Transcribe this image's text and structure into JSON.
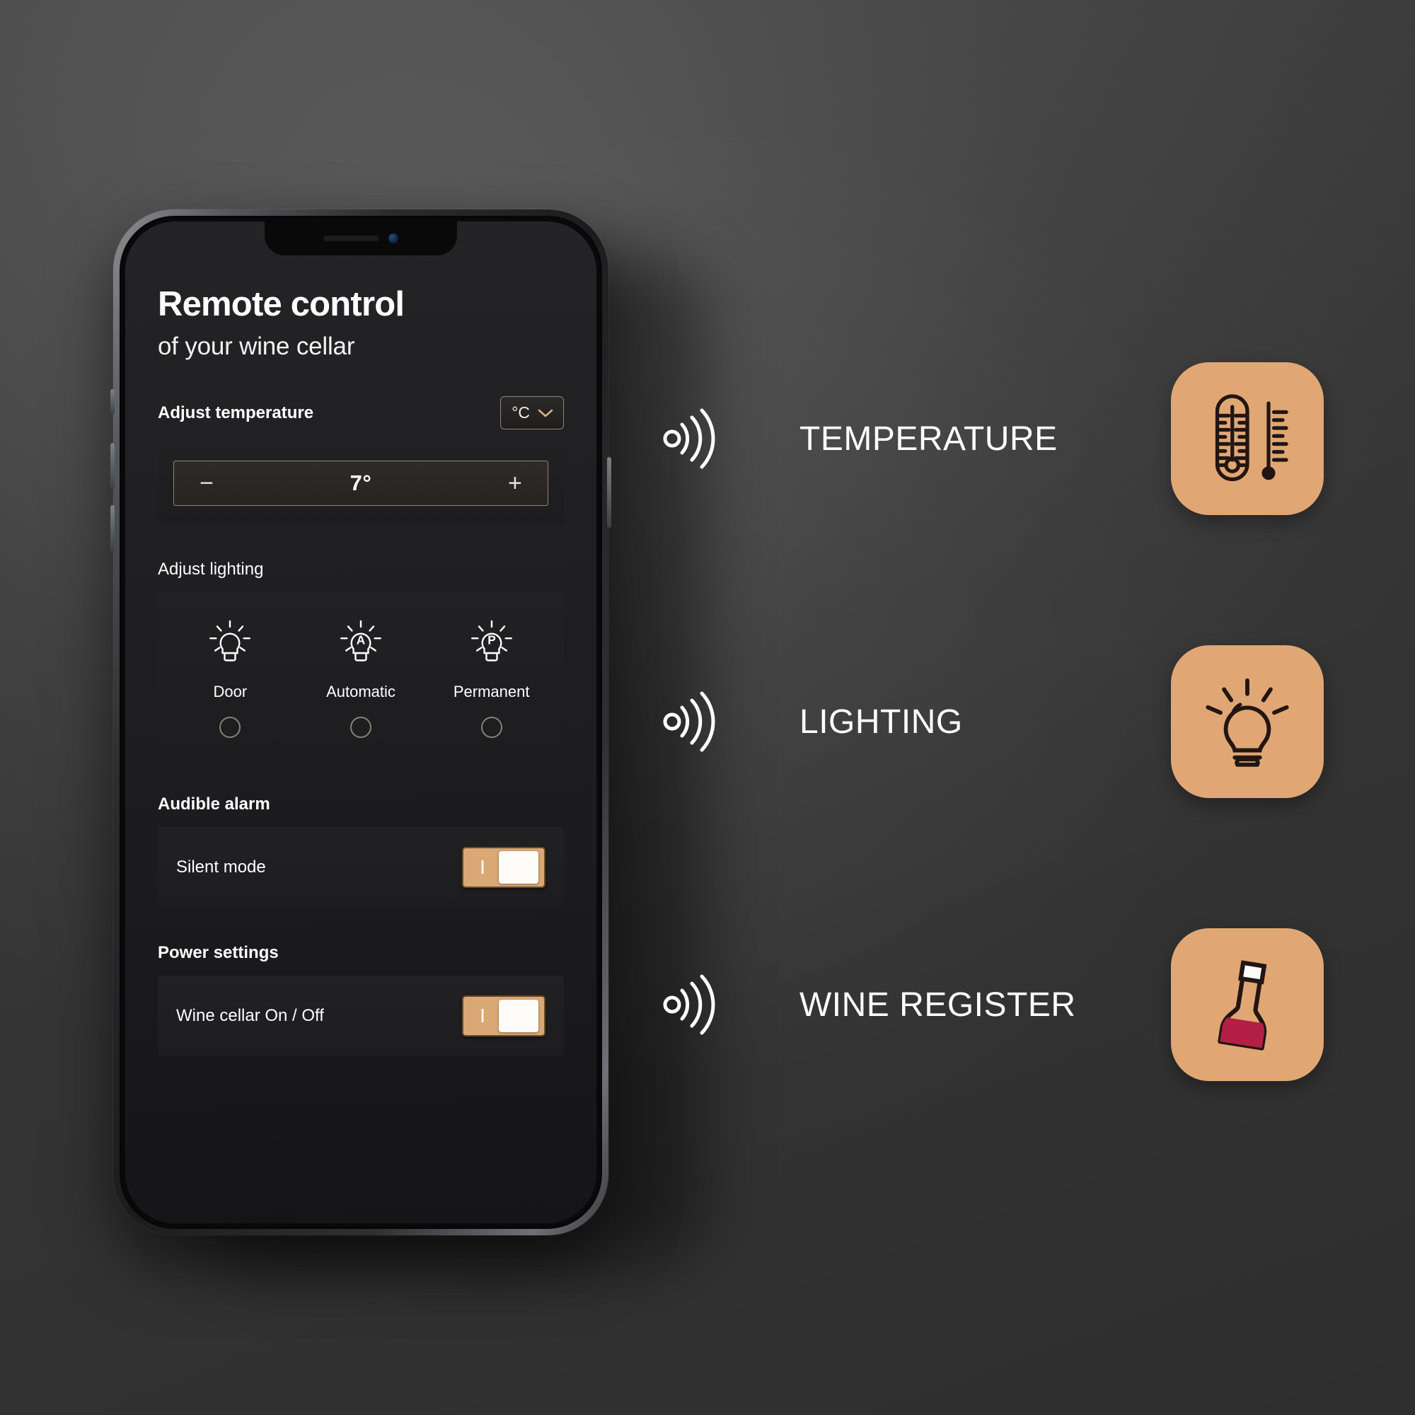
{
  "phone": {
    "app": {
      "title": "Remote control",
      "subtitle": "of your wine cellar",
      "temperature": {
        "section_label": "Adjust temperature",
        "unit": "°C",
        "unit_icon": "chevron-down-icon",
        "decrease_label": "−",
        "increase_label": "+",
        "value": "7°"
      },
      "lighting": {
        "section_label": "Adjust lighting",
        "options": [
          {
            "label": "Door",
            "icon": "lightbulb-icon",
            "glyph": "",
            "selected": false
          },
          {
            "label": "Automatic",
            "icon": "lightbulb-automatic-icon",
            "glyph": "A",
            "selected": false
          },
          {
            "label": "Permanent",
            "icon": "lightbulb-permanent-icon",
            "glyph": "P",
            "selected": false
          }
        ]
      },
      "alarm": {
        "section_label": "Audible alarm",
        "row_label": "Silent mode",
        "toggle_mark": "I"
      },
      "power": {
        "section_label": "Power settings",
        "row_label": "Wine cellar On / Off",
        "toggle_mark": "I"
      }
    }
  },
  "features": [
    {
      "label": "TEMPERATURE",
      "signal_icon": "wifi-signal-icon",
      "tile_icon": "thermometer-icon"
    },
    {
      "label": "LIGHTING",
      "signal_icon": "wifi-signal-icon",
      "tile_icon": "lightbulb-icon"
    },
    {
      "label": "WINE REGISTER",
      "signal_icon": "wifi-signal-icon",
      "tile_icon": "wine-bottle-icon"
    }
  ],
  "colors": {
    "accent_tan": "#e0a774",
    "toggle_tan": "#d9a875",
    "wine_red": "#b41f45",
    "icon_dark": "#231612",
    "background": "#4a4a4a",
    "screen_dark": "#1d1d1f"
  }
}
